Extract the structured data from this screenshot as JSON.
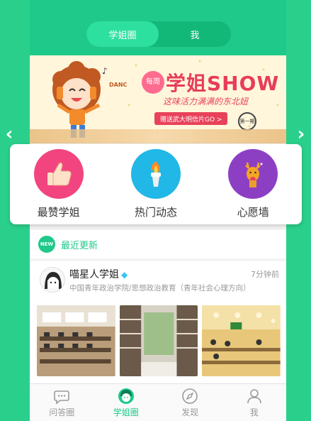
{
  "top_tabs": [
    {
      "label": "学姐圈",
      "active": true
    },
    {
      "label": "我",
      "active": false
    }
  ],
  "banner": {
    "badge": "每周",
    "title": "学姐SHOW",
    "subtitle": "这味活力满满的东北妞",
    "button": "赠送武大明信片GO >",
    "seal": "第一期",
    "dance_text": "DANCE"
  },
  "categories": [
    {
      "label": "最赞学姐",
      "icon": "thumbs-up-icon",
      "color": "#f2457f"
    },
    {
      "label": "热门动态",
      "icon": "torch-icon",
      "color": "#21b7e6"
    },
    {
      "label": "心愿墙",
      "icon": "reindeer-icon",
      "color": "#8d3fc4"
    }
  ],
  "news": {
    "badge": "NEW",
    "title": "最近更新"
  },
  "post": {
    "name": "喵星人学姐",
    "time": "7分钟前",
    "desc": "中国青年政治学院/思想政治教育（青年社会心理方向）"
  },
  "tabbar": [
    {
      "label": "问答圈",
      "icon": "chat-bubble-icon",
      "active": false
    },
    {
      "label": "学姐圈",
      "icon": "girl-face-icon",
      "active": true
    },
    {
      "label": "发现",
      "icon": "compass-icon",
      "active": false
    },
    {
      "label": "我",
      "icon": "person-icon",
      "active": false
    }
  ],
  "colors": {
    "brand": "#1ec98a",
    "banner_red": "#e8425a"
  }
}
